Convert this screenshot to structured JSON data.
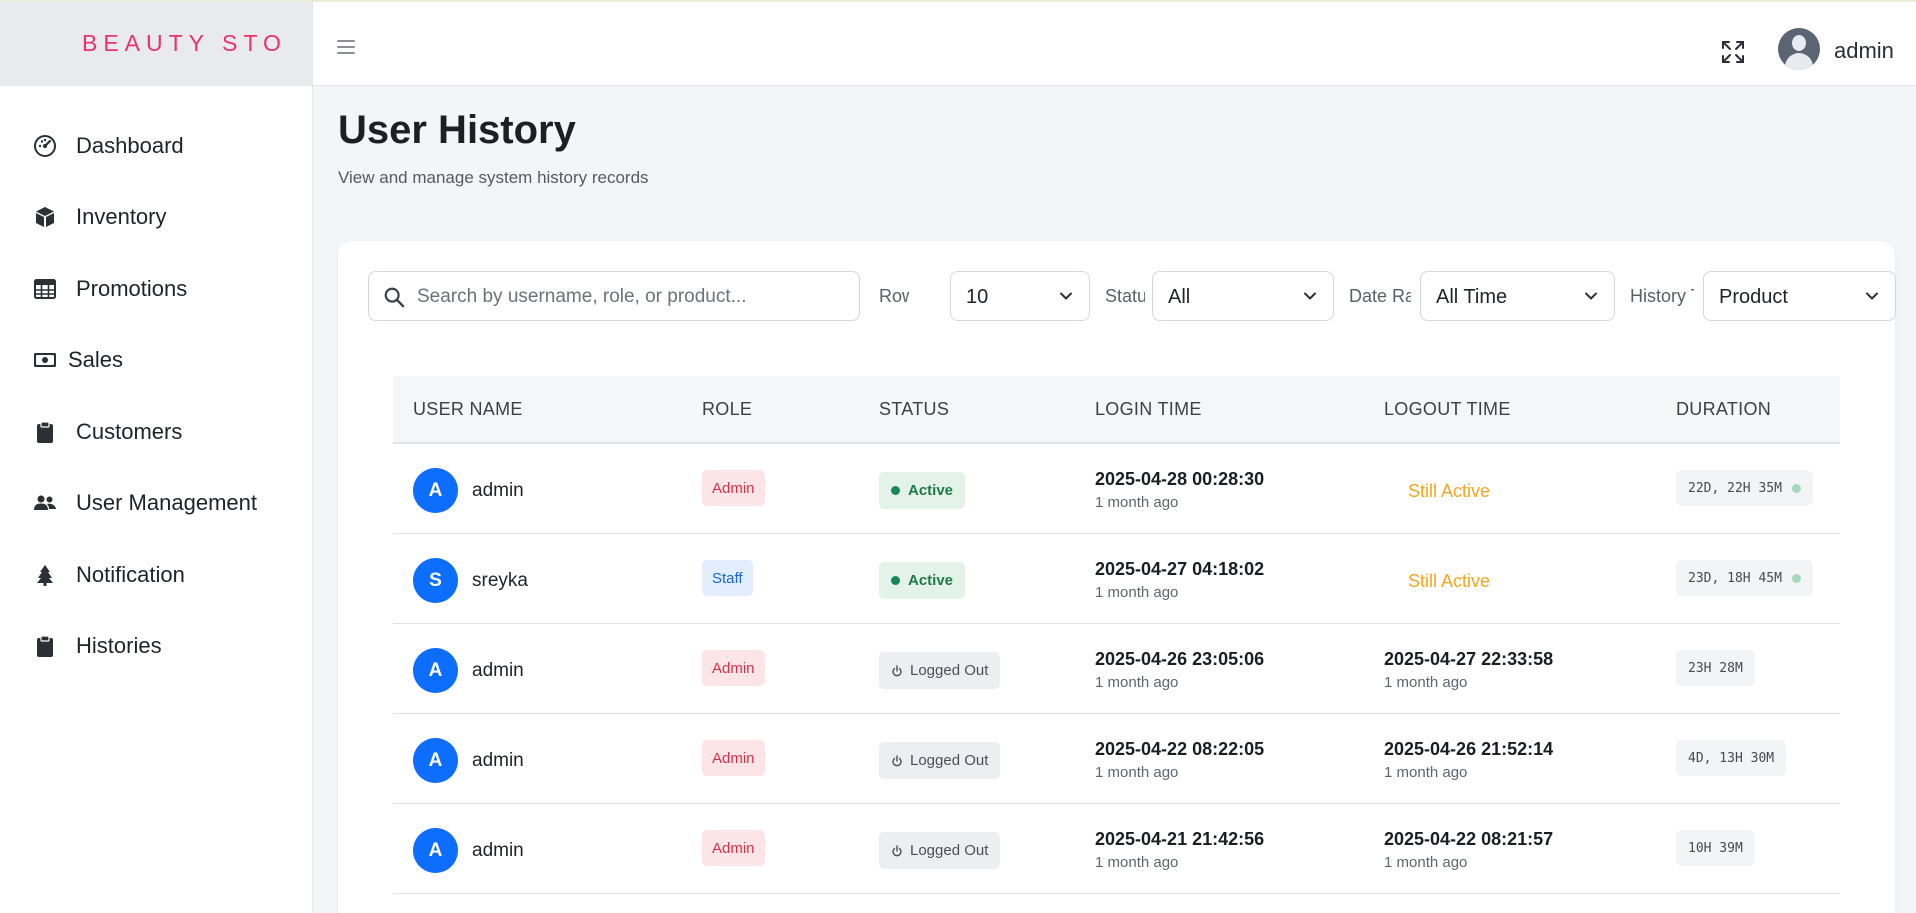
{
  "brand": {
    "name": "BEAUTY STO"
  },
  "sidebar": {
    "items": [
      {
        "label": "Dashboard",
        "icon": "gauge-icon"
      },
      {
        "label": "Inventory",
        "icon": "box-icon"
      },
      {
        "label": "Promotions",
        "icon": "table-icon"
      },
      {
        "label": "Sales",
        "icon": "money-icon"
      },
      {
        "label": "Customers",
        "icon": "clipboard-icon"
      },
      {
        "label": "User Management",
        "icon": "users-icon"
      },
      {
        "label": "Notification",
        "icon": "bell-icon"
      },
      {
        "label": "Histories",
        "icon": "clipboard-icon"
      }
    ]
  },
  "header": {
    "username": "admin"
  },
  "page": {
    "title": "User History",
    "subtitle": "View and manage system history records"
  },
  "filters": {
    "search_placeholder": "Search by username, role, or product...",
    "rows_label": "Row",
    "rows_value": "10",
    "status_label": "Statu",
    "status_value": "All",
    "date_label": "Date Ra",
    "date_value": "All Time",
    "history_label": "History T",
    "history_value": "Product"
  },
  "table": {
    "headers": [
      "USER NAME",
      "ROLE",
      "STATUS",
      "LOGIN TIME",
      "LOGOUT TIME",
      "DURATION"
    ],
    "rows": [
      {
        "initial": "A",
        "user": "admin",
        "role": "Admin",
        "role_type": "admin",
        "status": "Active",
        "status_type": "active",
        "login": "2025-04-28 00:28:30",
        "login_rel": "1 month ago",
        "logout": "",
        "logout_rel": "",
        "still_active": "Still Active",
        "duration": "22D, 22H 35M",
        "live": true
      },
      {
        "initial": "S",
        "user": "sreyka",
        "role": "Staff",
        "role_type": "staff",
        "status": "Active",
        "status_type": "active",
        "login": "2025-04-27 04:18:02",
        "login_rel": "1 month ago",
        "logout": "",
        "logout_rel": "",
        "still_active": "Still Active",
        "duration": "23D, 18H 45M",
        "live": true
      },
      {
        "initial": "A",
        "user": "admin",
        "role": "Admin",
        "role_type": "admin",
        "status": "Logged Out",
        "status_type": "out",
        "login": "2025-04-26 23:05:06",
        "login_rel": "1 month ago",
        "logout": "2025-04-27 22:33:58",
        "logout_rel": "1 month ago",
        "still_active": "",
        "duration": "23H 28M",
        "live": false
      },
      {
        "initial": "A",
        "user": "admin",
        "role": "Admin",
        "role_type": "admin",
        "status": "Logged Out",
        "status_type": "out",
        "login": "2025-04-22 08:22:05",
        "login_rel": "1 month ago",
        "logout": "2025-04-26 21:52:14",
        "logout_rel": "1 month ago",
        "still_active": "",
        "duration": "4D, 13H 30M",
        "live": false
      },
      {
        "initial": "A",
        "user": "admin",
        "role": "Admin",
        "role_type": "admin",
        "status": "Logged Out",
        "status_type": "out",
        "login": "2025-04-21 21:42:56",
        "login_rel": "1 month ago",
        "logout": "2025-04-22 08:21:57",
        "logout_rel": "1 month ago",
        "still_active": "",
        "duration": "10H 39M",
        "live": false
      }
    ]
  }
}
